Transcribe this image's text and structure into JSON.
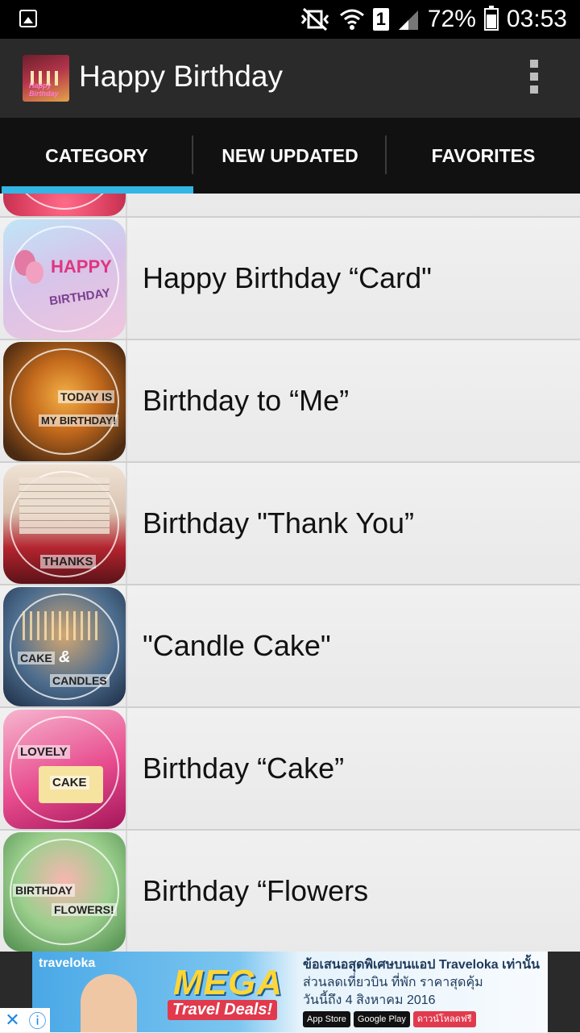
{
  "status_bar": {
    "battery_percent": "72%",
    "time": "03:53",
    "sim_slot": "1"
  },
  "app_bar": {
    "title": "Happy Birthday",
    "logo_text": "Happy Birthday"
  },
  "tabs": [
    {
      "label": "CATEGORY",
      "active": true
    },
    {
      "label": "NEW UPDATED",
      "active": false
    },
    {
      "label": "FAVORITES",
      "active": false
    }
  ],
  "categories": [
    {
      "label": "Happy Birthday “Card\"",
      "thumb_text": [
        "HAPPY",
        "BIRTHDAY"
      ]
    },
    {
      "label": "Birthday to “Me”",
      "thumb_text": [
        "TODAY IS",
        "MY BIRTHDAY!"
      ]
    },
    {
      "label": "Birthday \"Thank You”",
      "thumb_text": [
        "THANKS"
      ]
    },
    {
      "label": "\"Candle Cake\"",
      "thumb_text": [
        "CAKE",
        "&",
        "CANDLES"
      ]
    },
    {
      "label": "Birthday “Cake”",
      "thumb_text": [
        "LOVELY",
        "CAKE"
      ]
    },
    {
      "label": "Birthday “Flowers",
      "thumb_text": [
        "BIRTHDAY",
        "FLOWERS!"
      ]
    }
  ],
  "ad": {
    "brand": "traveloka",
    "headline": "MEGA",
    "subline": "Travel Deals!",
    "text_line1": "ข้อเสนอสุดพิเศษบนแอป Traveloka เท่านั้น",
    "text_line2": "ส่วนลดเที่ยวบิน ที่พัก ราคาสุดคุ้ม",
    "text_line3": "วันนี้ถึง 4 สิงหาคม 2016",
    "badge_appstore": "App Store",
    "badge_googleplay": "Google Play",
    "badge_download": "ดาวน์โหลดฟรี"
  }
}
